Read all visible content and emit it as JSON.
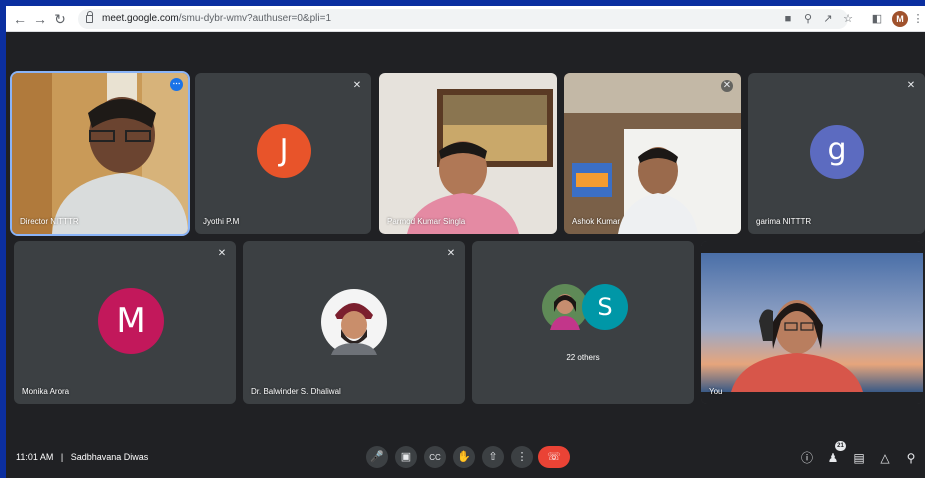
{
  "browser": {
    "url_host": "meet.google.com",
    "url_path": "/smu-dybr-wmv?authuser=0&pli=1",
    "profile_initial": "M"
  },
  "participants": {
    "director": {
      "name": "Director NITTTR"
    },
    "jyothi": {
      "name": "Jyothi P.M",
      "initial": "J",
      "color": "#e8542a"
    },
    "parmod": {
      "name": "Parmod Kumar Singla"
    },
    "ashok": {
      "name": "Ashok Kumar"
    },
    "garima": {
      "name": "garima NITTTR",
      "initial": "g",
      "color": "#5c6bc0"
    },
    "monika": {
      "name": "Monika Arora",
      "initial": "M",
      "color": "#c2185b"
    },
    "balwinder": {
      "name": "Dr. Balwinder S. Dhaliwal"
    },
    "others": {
      "label": "22 others",
      "initial": "S",
      "color": "#0097a7"
    },
    "you": {
      "name": "You"
    }
  },
  "bottom_bar": {
    "time": "11:01 AM",
    "separator": "|",
    "meeting_title": "Sadbhavana Diwas",
    "participant_count": "21"
  }
}
